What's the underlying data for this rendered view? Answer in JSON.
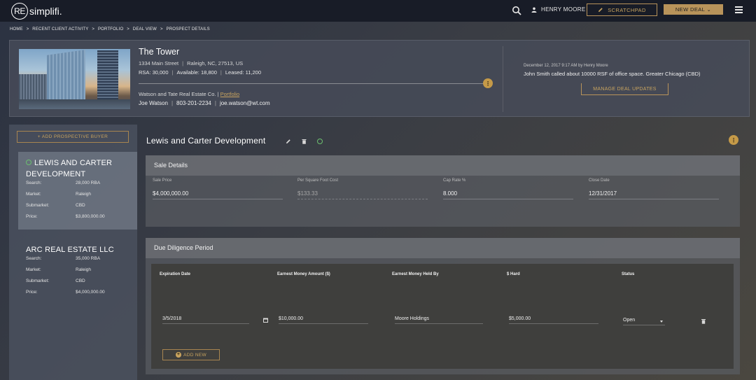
{
  "app": {
    "logo_mark": "RE",
    "logo_text": "simplifi."
  },
  "topbar": {
    "user_name": "HENRY MOORE",
    "scratchpad_label": "SCRATCHPAD",
    "new_deal_label": "NEW DEAL ⌄"
  },
  "breadcrumb": [
    "HOME",
    ">",
    "RECENT CLIENT ACTIVITY",
    ">",
    "PORTFOLIO",
    ">",
    "DEAL VIEW",
    ">",
    "PROSPECT DETAILS"
  ],
  "property": {
    "title": "The Tower",
    "street": "1334 Main Street",
    "city_state": "Raleigh, NC, 27513, US",
    "rsa": "RSA: 30,000",
    "available": "Available: 18,800",
    "leased": "Leased: 11,200",
    "company": "Watson and Tate Real Estate Co. |",
    "company_link": "Portfolio",
    "contact_name": "Joe Watson",
    "contact_phone": "803-201-2234",
    "contact_email": "joe.watson@wt.com",
    "more_glyph": "⋮"
  },
  "update": {
    "meta": "December 12, 2017 9:17 AM by Henry Moore",
    "text": "John Smith called about 10000 RSF of office space. Greater Chicago (CBD)",
    "manage_label": "MANAGE DEAL UPDATES"
  },
  "sidebar": {
    "add_buyer_label": "+ ADD PROSPECTIVE BUYER",
    "buyers": [
      {
        "name": "LEWIS AND CARTER DEVELOPMENT",
        "rows": [
          {
            "k": "Search:",
            "v": "28,000 RBA"
          },
          {
            "k": "Market:",
            "v": "Raleigh"
          },
          {
            "k": "Submarket:",
            "v": "CBD"
          },
          {
            "k": "Price:",
            "v": "$3,800,000.00"
          }
        ]
      },
      {
        "name": "ARC REAL ESTATE LLC",
        "rows": [
          {
            "k": "Search:",
            "v": "35,000 RBA"
          },
          {
            "k": "Market:",
            "v": "Raleigh"
          },
          {
            "k": "Submarket:",
            "v": "CBD"
          },
          {
            "k": "Price:",
            "v": "$4,000,000.00"
          }
        ]
      }
    ]
  },
  "deal": {
    "title": "Lewis and Carter Development",
    "more_glyph": "⋮"
  },
  "sale": {
    "heading": "Sale Details",
    "fields": [
      {
        "label": "Sale Price",
        "value": "$4,000,000.00"
      },
      {
        "label": "Per Square Foot Cost",
        "value": "$133.33"
      },
      {
        "label": "Cap Rate %",
        "value": "8.000"
      },
      {
        "label": "Close Date",
        "value": "12/31/2017"
      }
    ]
  },
  "due_diligence": {
    "heading": "Due Diligence Period",
    "columns": [
      "Expiration Date",
      "Earnest Money Amount ($)",
      "Earnest Money Held By",
      "$ Hard",
      "Status"
    ],
    "row": {
      "date": "3/5/2018",
      "amount": "$10,000.00",
      "held_by": "Moore Holdings",
      "hard": "$5,000.00",
      "status": "Open"
    },
    "add_new_label": "ADD NEW"
  },
  "colors": {
    "accent": "#b8935a",
    "topbar": "#181c27",
    "refresh": "#6cc070"
  }
}
